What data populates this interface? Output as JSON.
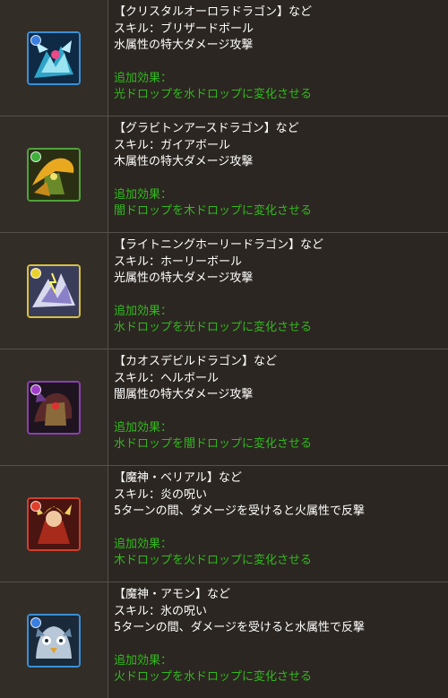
{
  "rows": [
    {
      "title": "【クリスタルオーロラドラゴン】など",
      "skill": "スキル：ブリザードボール",
      "effect": "水属性の特大ダメージ攻撃",
      "extra_label": "追加効果：",
      "extra_text": "光ドロップを水ドロップに変化させる",
      "icon": "crystal-aurora-dragon-icon",
      "frame_color": "#3b8fd6",
      "attr_color": "#3a7fe0"
    },
    {
      "title": "【グラビトンアースドラゴン】など",
      "skill": "スキル：ガイアボール",
      "effect": "木属性の特大ダメージ攻撃",
      "extra_label": "追加効果：",
      "extra_text": "闇ドロップを木ドロップに変化させる",
      "icon": "graviton-earth-dragon-icon",
      "frame_color": "#4fa33a",
      "attr_color": "#3fb03a"
    },
    {
      "title": "【ライトニングホーリードラゴン】など",
      "skill": "スキル：ホーリーボール",
      "effect": "光属性の特大ダメージ攻撃",
      "extra_label": "追加効果：",
      "extra_text": "水ドロップを光ドロップに変化させる",
      "icon": "lightning-holy-dragon-icon",
      "frame_color": "#d8c040",
      "attr_color": "#e8d030"
    },
    {
      "title": "【カオスデビルドラゴン】など",
      "skill": "スキル：ヘルボール",
      "effect": "闇属性の特大ダメージ攻撃",
      "extra_label": "追加効果：",
      "extra_text": "水ドロップを闇ドロップに変化させる",
      "icon": "chaos-devil-dragon-icon",
      "frame_color": "#8a3fb0",
      "attr_color": "#a040c8"
    },
    {
      "title": "【魔神・ベリアル】など",
      "skill": "スキル：炎の呪い",
      "effect": "5ターンの間、ダメージを受けると火属性で反撃",
      "extra_label": "追加効果：",
      "extra_text": "木ドロップを火ドロップに変化させる",
      "icon": "demon-belial-icon",
      "frame_color": "#d0402a",
      "attr_color": "#e0402a"
    },
    {
      "title": "【魔神・アモン】など",
      "skill": "スキル：氷の呪い",
      "effect": "5ターンの間、ダメージを受けると水属性で反撃",
      "extra_label": "追加効果：",
      "extra_text": "火ドロップを水ドロップに変化させる",
      "icon": "demon-amon-icon",
      "frame_color": "#3b8fd6",
      "attr_color": "#3a7fe0"
    }
  ]
}
